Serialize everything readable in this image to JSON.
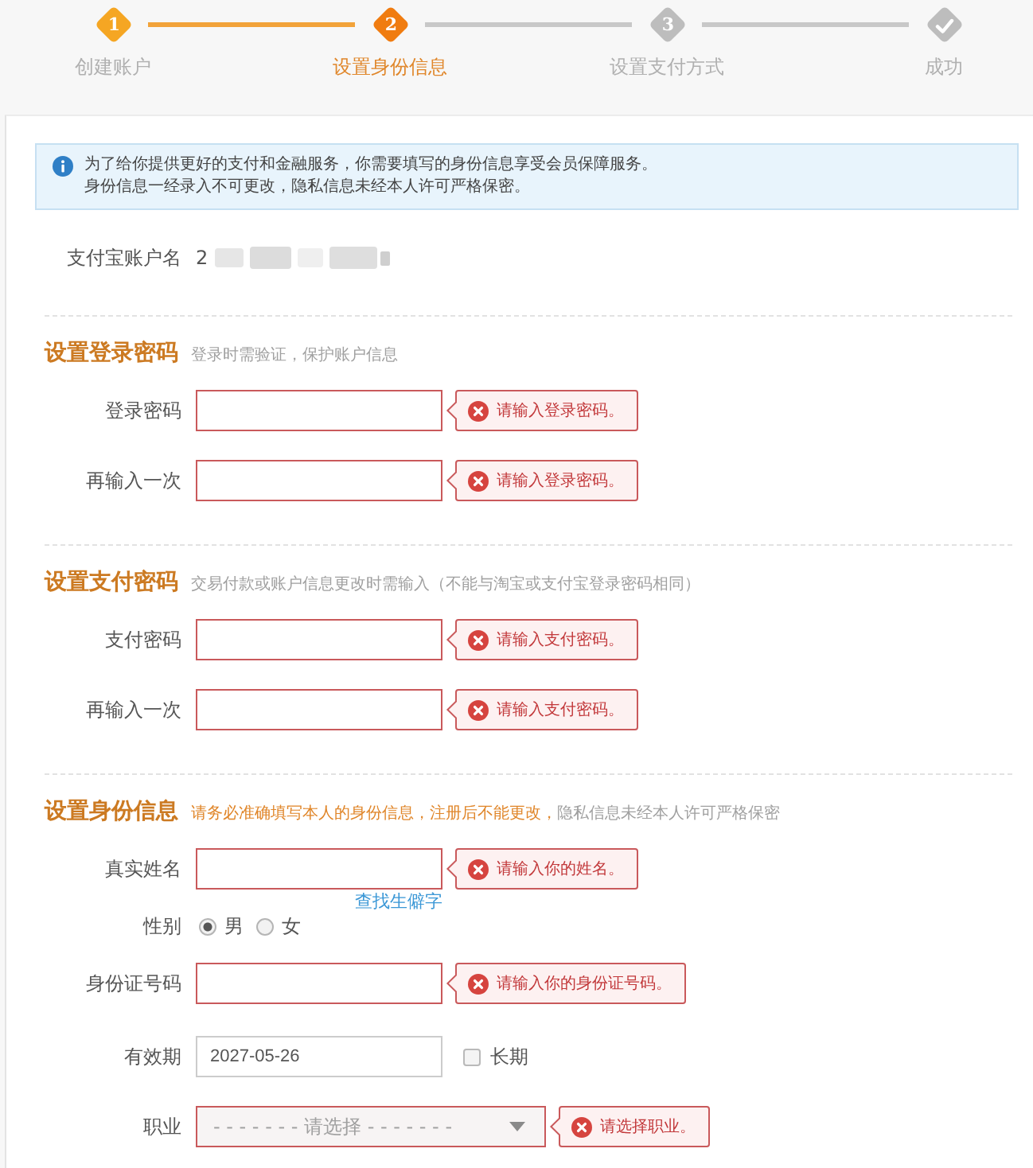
{
  "steps": [
    {
      "kind": "number",
      "number": "1",
      "label": "创建账户",
      "selected": false
    },
    {
      "kind": "number",
      "number": "2",
      "label": "设置身份信息",
      "selected": true
    },
    {
      "kind": "number",
      "number": "3",
      "label": "设置支付方式",
      "selected": false
    },
    {
      "kind": "check",
      "label": "成功",
      "selected": false
    }
  ],
  "notice": {
    "lines": [
      "为了给你提供更好的支付和金融服务，你需要填写的身份信息享受会员保障服务。",
      "身份信息一经录入不可更改，隐私信息未经本人许可严格保密。"
    ]
  },
  "account": {
    "label": "支付宝账户名",
    "value": "2"
  },
  "sections": [
    {
      "title": "设置登录密码",
      "hint": [
        {
          "text": "登录时需验证，保护账户信息",
          "warning": false
        }
      ],
      "fields": [
        {
          "kind": "password",
          "label": "登录密码",
          "error": "请输入登录密码。"
        },
        {
          "kind": "password",
          "label": "再输入一次",
          "error": "请输入登录密码。"
        }
      ]
    },
    {
      "title": "设置支付密码",
      "hint": [
        {
          "text": "交易付款或账户信息更改时需输入（不能与淘宝或支付宝登录密码相同）",
          "warning": false
        }
      ],
      "fields": [
        {
          "kind": "password",
          "label": "支付密码",
          "error": "请输入支付密码。"
        },
        {
          "kind": "password",
          "label": "再输入一次",
          "error": "请输入支付密码。"
        }
      ]
    },
    {
      "title": "设置身份信息",
      "hint": [
        {
          "text": "请务必准确填写本人的身份信息，注册后不能更改，",
          "warning": true
        },
        {
          "text": "隐私信息未经本人许可严格保密",
          "warning": false
        }
      ],
      "fields": [
        {
          "kind": "text",
          "label": "真实姓名",
          "error": "请输入你的姓名。",
          "link": "查找生僻字"
        },
        {
          "kind": "radio",
          "label": "性别",
          "options": [
            {
              "label": "男",
              "selected": true
            },
            {
              "label": "女",
              "selected": false
            }
          ]
        },
        {
          "kind": "text",
          "label": "身份证号码",
          "error": "请输入你的身份证号码。"
        },
        {
          "kind": "date",
          "label": "有效期",
          "value": "2027-05-26",
          "checkbox": {
            "label": "长期",
            "checked": false
          }
        },
        {
          "kind": "select",
          "label": "职业",
          "placeholder": "- - - - - - - 请选择 - - - - - - -",
          "error": "请选择职业。"
        }
      ]
    }
  ]
}
